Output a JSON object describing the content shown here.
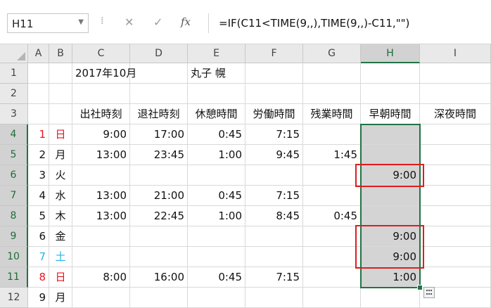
{
  "formula_bar": {
    "name_box": "H11",
    "cancel_icon": "✕",
    "enter_icon": "✓",
    "fx_label": "fx",
    "formula": "=IF(C11<TIME(9,,),TIME(9,,)-C11,\"\")"
  },
  "columns": [
    "A",
    "B",
    "C",
    "D",
    "E",
    "F",
    "G",
    "H",
    "I"
  ],
  "rows": [
    "1",
    "2",
    "3",
    "4",
    "5",
    "6",
    "7",
    "8",
    "9",
    "10",
    "11",
    "12"
  ],
  "selected_cell": "H11",
  "header_rows": {
    "r1": {
      "C": "2017年10月",
      "E": "丸子 幌"
    },
    "r3": {
      "C": "出社時刻",
      "D": "退社時刻",
      "E": "休憩時間",
      "F": "労働時間",
      "G": "残業時間",
      "H": "早朝時間",
      "I": "深夜時間"
    }
  },
  "data_rows": [
    {
      "A": "1",
      "B": "日",
      "C": "9:00",
      "D": "17:00",
      "E": "0:45",
      "F": "7:15",
      "G": "",
      "H": ""
    },
    {
      "A": "2",
      "B": "月",
      "C": "13:00",
      "D": "23:45",
      "E": "1:00",
      "F": "9:45",
      "G": "1:45",
      "H": ""
    },
    {
      "A": "3",
      "B": "火",
      "C": "",
      "D": "",
      "E": "",
      "F": "",
      "G": "",
      "H": "9:00"
    },
    {
      "A": "4",
      "B": "水",
      "C": "13:00",
      "D": "21:00",
      "E": "0:45",
      "F": "7:15",
      "G": "",
      "H": ""
    },
    {
      "A": "5",
      "B": "木",
      "C": "13:00",
      "D": "22:45",
      "E": "1:00",
      "F": "8:45",
      "G": "0:45",
      "H": ""
    },
    {
      "A": "6",
      "B": "金",
      "C": "",
      "D": "",
      "E": "",
      "F": "",
      "G": "",
      "H": "9:00"
    },
    {
      "A": "7",
      "B": "土",
      "C": "",
      "D": "",
      "E": "",
      "F": "",
      "G": "",
      "H": "9:00"
    },
    {
      "A": "8",
      "B": "日",
      "C": "8:00",
      "D": "16:00",
      "E": "0:45",
      "F": "7:15",
      "G": "",
      "H": "1:00"
    },
    {
      "A": "9",
      "B": "月",
      "C": "",
      "D": "",
      "E": "",
      "F": "",
      "G": "",
      "H": ""
    }
  ],
  "colors": {
    "sunday": "#e8141c",
    "saturday": "#20b5e8",
    "selection": "#217346",
    "highlight_box": "#e01d1d"
  }
}
